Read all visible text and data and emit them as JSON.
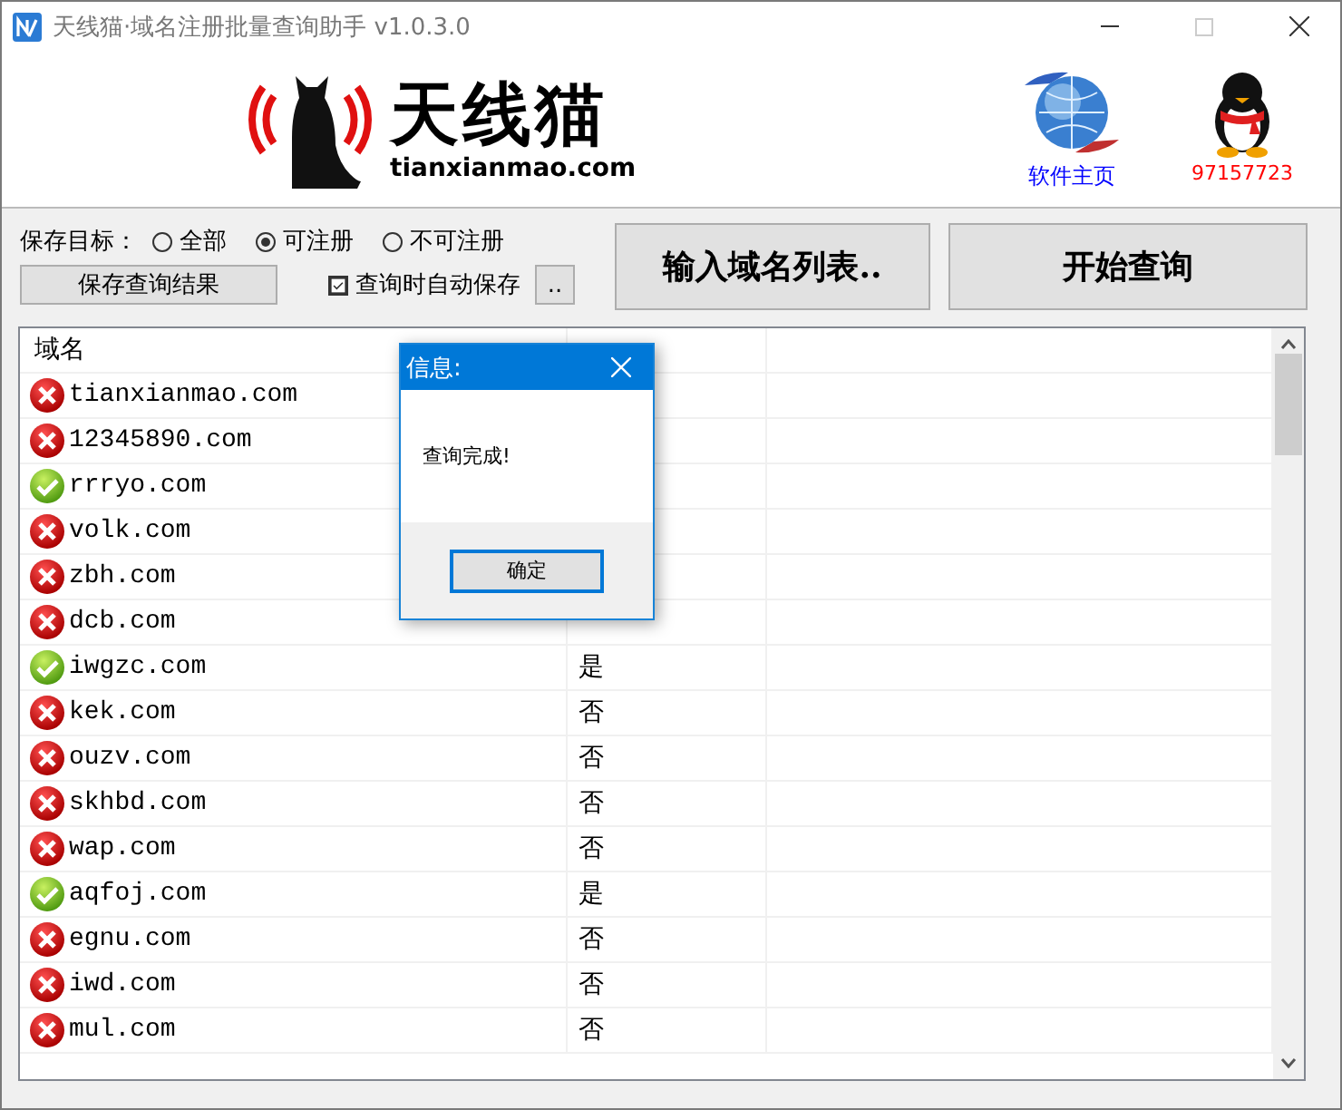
{
  "window": {
    "title": "天线猫·域名注册批量查询助手 v1.0.3.0"
  },
  "logo": {
    "name": "天线猫",
    "site": "tianxianmao.com"
  },
  "links": [
    {
      "kind": "globe",
      "label": "软件主页"
    },
    {
      "kind": "penguin",
      "label": "97157723"
    }
  ],
  "save_target": {
    "label": "保存目标：",
    "options": [
      {
        "label": "全部",
        "selected": false
      },
      {
        "label": "可注册",
        "selected": true
      },
      {
        "label": "不可注册",
        "selected": false
      }
    ]
  },
  "save_button": "保存查询结果",
  "auto_save": {
    "label": "查询时自动保存",
    "checked": true
  },
  "browse_button": "..",
  "input_button": "输入域名列表..",
  "start_button": "开始查询",
  "table": {
    "columns": [
      "域名"
    ],
    "rows": [
      {
        "domain": "tianxianmao.com",
        "registrable": false
      },
      {
        "domain": "12345890.com",
        "registrable": false
      },
      {
        "domain": "rrryo.com",
        "registrable": true
      },
      {
        "domain": "volk.com",
        "registrable": false
      },
      {
        "domain": "zbh.com",
        "registrable": false
      },
      {
        "domain": "dcb.com",
        "registrable": false
      },
      {
        "domain": "iwgzc.com",
        "registrable": true,
        "status": "是"
      },
      {
        "domain": "kek.com",
        "registrable": false,
        "status": "否"
      },
      {
        "domain": "ouzv.com",
        "registrable": false,
        "status": "否"
      },
      {
        "domain": "skhbd.com",
        "registrable": false,
        "status": "否"
      },
      {
        "domain": "wap.com",
        "registrable": false,
        "status": "否"
      },
      {
        "domain": "aqfoj.com",
        "registrable": true,
        "status": "是"
      },
      {
        "domain": "egnu.com",
        "registrable": false,
        "status": "否"
      },
      {
        "domain": "iwd.com",
        "registrable": false,
        "status": "否"
      },
      {
        "domain": "mul.com",
        "registrable": false,
        "status": "否"
      }
    ]
  },
  "dialog": {
    "title": "信息:",
    "message": "查询完成!",
    "ok_button": "确定"
  }
}
